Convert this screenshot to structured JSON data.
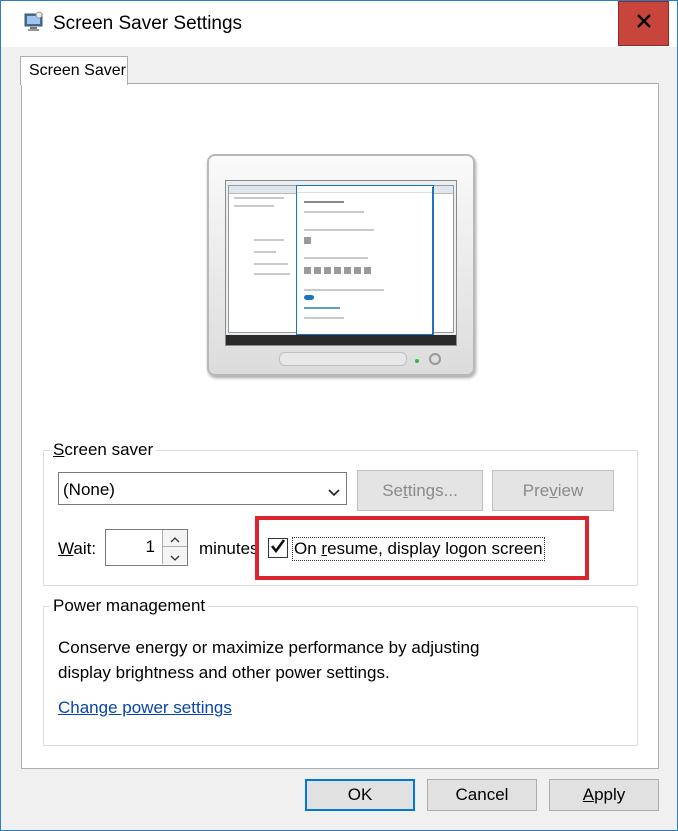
{
  "window": {
    "title": "Screen Saver Settings",
    "close_glyph": "✕"
  },
  "tabs": [
    {
      "label": "Screen Saver",
      "selected": true
    }
  ],
  "screen_saver": {
    "group_label_underlined": "S",
    "group_label_rest": "creen saver",
    "selected": "(None)",
    "settings_button": {
      "pre": "Se",
      "ul": "t",
      "post": "tings...",
      "enabled": false
    },
    "preview_button": {
      "pre": "Pre",
      "ul": "v",
      "post": "iew",
      "enabled": false
    },
    "wait_label_ul": "W",
    "wait_label_rest": "ait:",
    "wait_value": "1",
    "minutes_label": "minutes",
    "resume_checkbox": {
      "checked": true,
      "label_pre": "On ",
      "label_ul": "r",
      "label_post": "esume, display logon screen"
    },
    "highlight_color": "#d9252d"
  },
  "power_management": {
    "group_label": "Power management",
    "description_line1": "Conserve energy or maximize performance by adjusting",
    "description_line2": "display brightness and other power settings.",
    "link": "Change power settings"
  },
  "footer": {
    "ok": "OK",
    "cancel": "Cancel",
    "apply_ul": "A",
    "apply_rest": "pply"
  },
  "colors": {
    "close_button": "#c8453b",
    "link": "#0645ad",
    "accent": "#0078d7"
  }
}
